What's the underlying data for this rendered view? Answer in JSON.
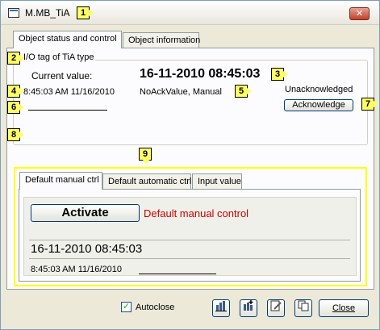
{
  "window": {
    "title": "M.MB_TiA",
    "close_glyph": "✕"
  },
  "callouts": [
    "1",
    "2",
    "3",
    "4",
    "5",
    "6",
    "7",
    "8",
    "9"
  ],
  "tabs_top": [
    {
      "label": "Object status and control",
      "active": true
    },
    {
      "label": "Object information",
      "active": false
    }
  ],
  "status": {
    "group_title": "I/O tag of TiA type",
    "current_label": "Current value:",
    "current_value": "16-11-2010 08:45:03",
    "timestamp": "8:45:03 AM 11/16/2010",
    "state": "NoAckValue, Manual",
    "ack_state": "Unacknowledged",
    "ack_button": "Acknowledge"
  },
  "tabs_bottom": [
    {
      "label": "Default manual ctrl",
      "active": true
    },
    {
      "label": "Default automatic ctrl",
      "active": false
    },
    {
      "label": "Input value",
      "active": false
    }
  ],
  "manual": {
    "activate_button": "Activate",
    "mode_text": "Default manual control",
    "value": "16-11-2010 08:45:03",
    "timestamp": "8:45:03 AM 11/16/2010"
  },
  "footer": {
    "autoclose_label": "Autoclose",
    "autoclose_checked": true,
    "close_button": "Close"
  },
  "colors": {
    "mode_text": "#cc0000",
    "highlight": "#ffff00",
    "callout": "#ffff66"
  },
  "icons": [
    "bar-chart-icon",
    "faceplate-add-icon",
    "document-edit-icon",
    "copy-icon"
  ]
}
